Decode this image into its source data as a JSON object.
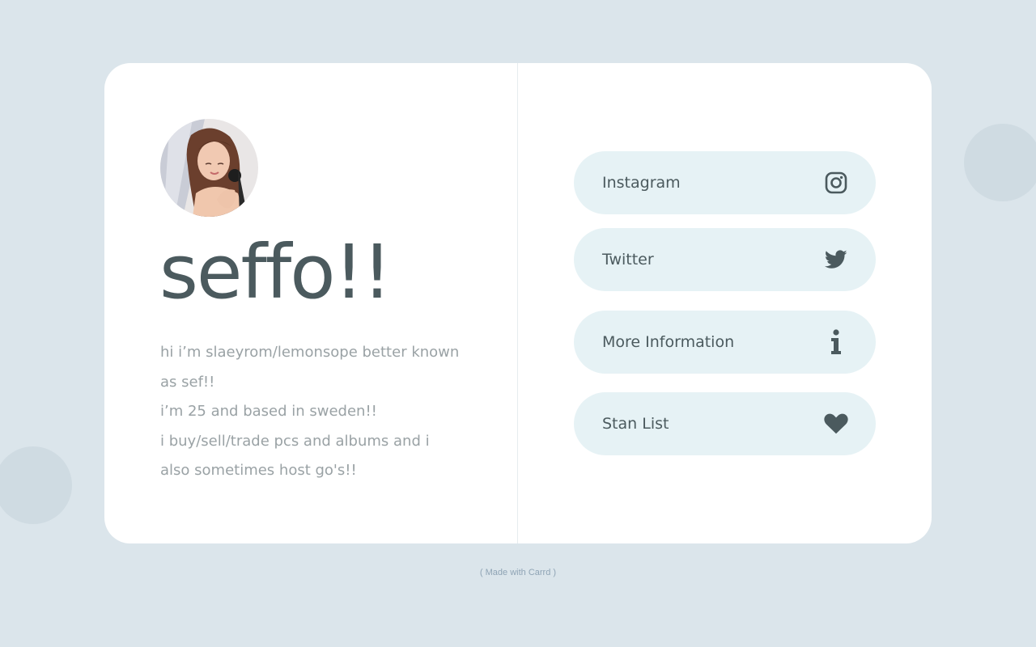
{
  "profile": {
    "avatar_alt": "profile photo",
    "headline": "seffo!!",
    "bio_lines": [
      "hi i’m slaeyrom/lemonsope better known as sef!!",
      "i’m 25 and based in sweden!!",
      "i buy/sell/trade pcs and albums and i also sometimes host go's!!"
    ]
  },
  "links": [
    {
      "label": "Instagram",
      "icon": "instagram-icon"
    },
    {
      "label": "Twitter",
      "icon": "twitter-icon"
    },
    {
      "label": "More Information",
      "icon": "info-icon"
    },
    {
      "label": "Stan List",
      "icon": "heart-icon"
    }
  ],
  "footer": {
    "text": "( Made with Carrd )"
  },
  "colors": {
    "page_background": "#dbe5eb",
    "card_background": "#ffffff",
    "button_background": "#e6f2f5",
    "text_dark": "#4b5a5e",
    "text_muted": "#9aa2a5",
    "footer_text": "#8fa4b5"
  }
}
